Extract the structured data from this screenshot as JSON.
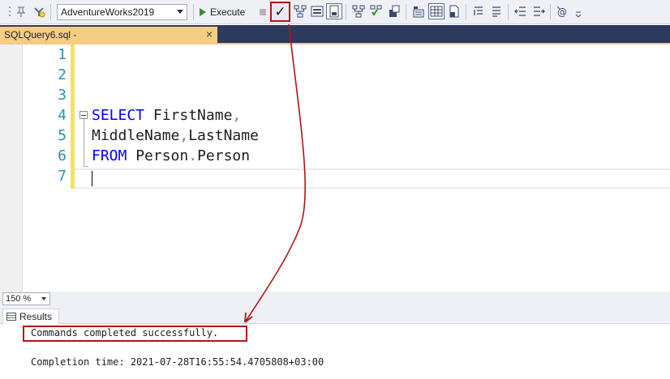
{
  "toolbar": {
    "database": "AdventureWorks2019",
    "execute_label": "Execute",
    "icons": [
      "options-icon",
      "pin-icon",
      "add-connection-icon",
      "execute-icon",
      "stop-icon",
      "parse-icon",
      "display-plan-icon",
      "results-to-text-icon",
      "results-to-grid-icon",
      "results-to-file-icon",
      "comment-icon",
      "uncomment-icon",
      "decrease-indent-icon",
      "increase-indent-icon",
      "specify-values-icon"
    ]
  },
  "tab": {
    "title": "SQLQuery6.sql -",
    "close_glyph": "×"
  },
  "editor": {
    "line_numbers": [
      "1",
      "2",
      "3",
      "4",
      "5",
      "6",
      "7"
    ],
    "line4_kw": "SELECT",
    "line4_rest": " FirstName",
    "line4_comma": ",",
    "line5_a": "MiddleName",
    "line5_comma": ",",
    "line5_b": "LastName",
    "line6_kw": "FROM",
    "line6_a": " Person",
    "line6_dot": ".",
    "line6_b": "Person"
  },
  "zoom": {
    "value": "150 %"
  },
  "results": {
    "tab_label": "Results",
    "message": "Commands completed successfully.",
    "completion": "Completion time: 2021-07-28T16:55:54.4705808+03:00"
  },
  "colors": {
    "highlight_red": "#b11515",
    "keyword_blue": "#0000ff",
    "line_number_teal": "#2b91af",
    "tab_gold": "#f5cc84",
    "tabstrip_navy": "#2d3a5e"
  }
}
